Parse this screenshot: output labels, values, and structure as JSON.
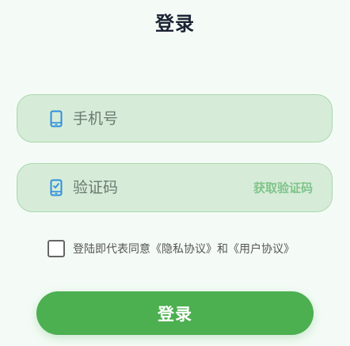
{
  "header": {
    "title": "登录"
  },
  "form": {
    "phone": {
      "placeholder": "手机号",
      "value": "",
      "icon": "phone-icon"
    },
    "code": {
      "placeholder": "验证码",
      "value": "",
      "icon": "verify-code-icon",
      "get_code_label": "获取验证码"
    },
    "agreement": {
      "checked": false,
      "prefix": "登陆即代表同意",
      "privacy_link": "《隐私协议》",
      "conjunction": "和",
      "user_link": "《用户协议》"
    },
    "submit_label": "登录"
  },
  "colors": {
    "background": "#f4fbf6",
    "field_bg": "#d6ecd8",
    "field_border": "#a9d8ae",
    "accent": "#4caf50",
    "icon_blue": "#2f8fdc",
    "link_green": "#7fc48a"
  }
}
